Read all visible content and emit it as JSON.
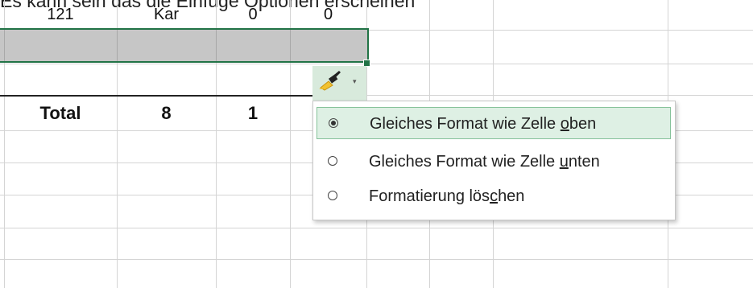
{
  "caption": "Es kann sein das die Einfüge Optionen erscheinen",
  "row_top": {
    "col_a": "121",
    "col_b": "Kar",
    "col_c": "0",
    "col_d": "0"
  },
  "row_total": {
    "label": "Total",
    "col_b": "8",
    "col_c": "1"
  },
  "paste_button": {
    "icon": "paintbrush-icon",
    "caret": "▾"
  },
  "menu": {
    "selected_index": 0,
    "items": [
      {
        "pre": "Gleiches Format wie Zelle ",
        "key": "o",
        "post": "ben",
        "selected": true
      },
      {
        "pre": "Gleiches Format wie Zelle ",
        "key": "u",
        "post": "nten",
        "selected": false
      },
      {
        "pre": "Formatierung lös",
        "key": "c",
        "post": "hen",
        "selected": false
      }
    ]
  },
  "colors": {
    "accent_green": "#217346",
    "selected_row_fill": "#c6c6c6",
    "menu_highlight": "#def0e4"
  }
}
